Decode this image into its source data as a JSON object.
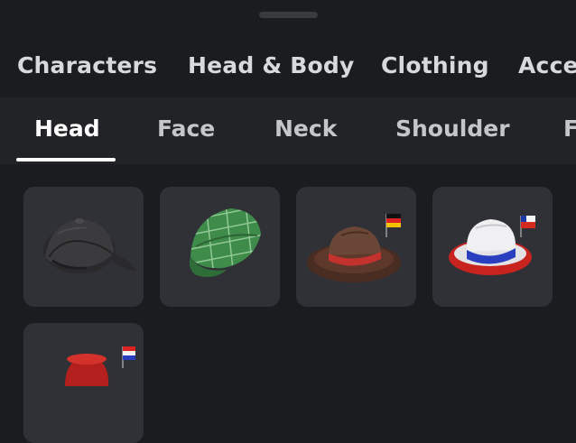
{
  "category_tabs": [
    {
      "label": "Characters"
    },
    {
      "label": "Head & Body"
    },
    {
      "label": "Clothing"
    },
    {
      "label": "Acce"
    }
  ],
  "sub_tabs": [
    {
      "label": "Head",
      "active": true
    },
    {
      "label": "Face"
    },
    {
      "label": "Neck"
    },
    {
      "label": "Shoulder"
    },
    {
      "label": "F"
    }
  ],
  "items": [
    {
      "icon": "black-baseball-cap-icon"
    },
    {
      "icon": "green-plaid-cap-icon"
    },
    {
      "icon": "brown-fedora-germany-flag-icon"
    },
    {
      "icon": "white-fedora-chile-flag-icon"
    },
    {
      "icon": "red-hat-flag-icon"
    }
  ],
  "colors": {
    "background": "#1b1c1f",
    "subbar": "#222326",
    "tile": "#303136",
    "active_tab": "#ffffff"
  }
}
